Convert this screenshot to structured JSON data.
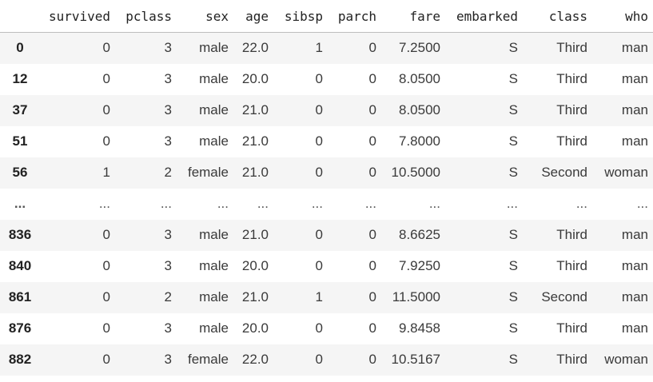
{
  "columns": [
    "",
    "survived",
    "pclass",
    "sex",
    "age",
    "sibsp",
    "parch",
    "fare",
    "embarked",
    "class",
    "who"
  ],
  "rows": [
    [
      "0",
      "0",
      "3",
      "male",
      "22.0",
      "1",
      "0",
      "7.2500",
      "S",
      "Third",
      "man"
    ],
    [
      "12",
      "0",
      "3",
      "male",
      "20.0",
      "0",
      "0",
      "8.0500",
      "S",
      "Third",
      "man"
    ],
    [
      "37",
      "0",
      "3",
      "male",
      "21.0",
      "0",
      "0",
      "8.0500",
      "S",
      "Third",
      "man"
    ],
    [
      "51",
      "0",
      "3",
      "male",
      "21.0",
      "0",
      "0",
      "7.8000",
      "S",
      "Third",
      "man"
    ],
    [
      "56",
      "1",
      "2",
      "female",
      "21.0",
      "0",
      "0",
      "10.5000",
      "S",
      "Second",
      "woman"
    ],
    [
      "...",
      "...",
      "...",
      "...",
      "...",
      "...",
      "...",
      "...",
      "...",
      "...",
      "..."
    ],
    [
      "836",
      "0",
      "3",
      "male",
      "21.0",
      "0",
      "0",
      "8.6625",
      "S",
      "Third",
      "man"
    ],
    [
      "840",
      "0",
      "3",
      "male",
      "20.0",
      "0",
      "0",
      "7.9250",
      "S",
      "Third",
      "man"
    ],
    [
      "861",
      "0",
      "2",
      "male",
      "21.0",
      "1",
      "0",
      "11.5000",
      "S",
      "Second",
      "man"
    ],
    [
      "876",
      "0",
      "3",
      "male",
      "20.0",
      "0",
      "0",
      "9.8458",
      "S",
      "Third",
      "man"
    ],
    [
      "882",
      "0",
      "3",
      "female",
      "22.0",
      "0",
      "0",
      "10.5167",
      "S",
      "Third",
      "woman"
    ]
  ]
}
